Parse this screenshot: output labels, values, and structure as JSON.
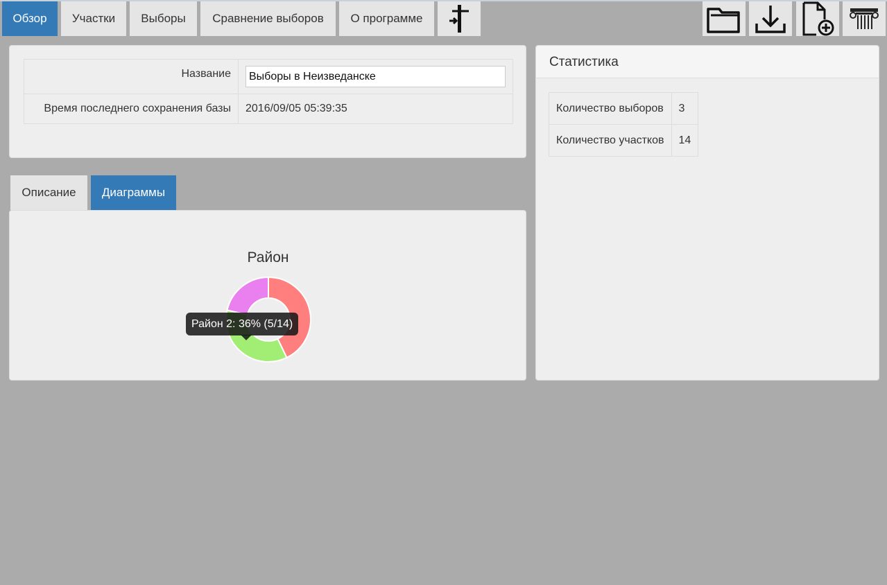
{
  "nav": {
    "tabs": [
      {
        "label": "Обзор",
        "active": true
      },
      {
        "label": "Участки",
        "active": false
      },
      {
        "label": "Выборы",
        "active": false
      },
      {
        "label": "Сравнение выборов",
        "active": false
      },
      {
        "label": "О программе",
        "active": false
      }
    ],
    "icons": [
      "signpost-icon",
      "folder-icon",
      "download-icon",
      "new-file-icon",
      "column-icon"
    ]
  },
  "info": {
    "name_label": "Название",
    "name_value": "Выборы в Неизведанске",
    "saved_label": "Время последнего сохранения базы",
    "saved_value": "2016/09/05 05:39:35"
  },
  "subtabs": [
    {
      "label": "Описание",
      "active": false
    },
    {
      "label": "Диаграммы",
      "active": true
    }
  ],
  "stats": {
    "title": "Статистика",
    "rows": [
      {
        "label": "Количество выборов",
        "value": "3"
      },
      {
        "label": "Количество участков",
        "value": "14"
      }
    ]
  },
  "chart_data": {
    "type": "pie",
    "title": "Район",
    "slices": [
      {
        "name": "",
        "value": 6,
        "color": "#ff7f7f"
      },
      {
        "name": "Район 2",
        "value": 5,
        "color": "#a2ed74"
      },
      {
        "name": "",
        "value": 3,
        "color": "#ea7ff0"
      }
    ],
    "tooltip": "Район 2: 36% (5/14)"
  },
  "colors": {
    "accent": "#337ab7",
    "background": "#ababab",
    "panel": "#eeeeee"
  }
}
